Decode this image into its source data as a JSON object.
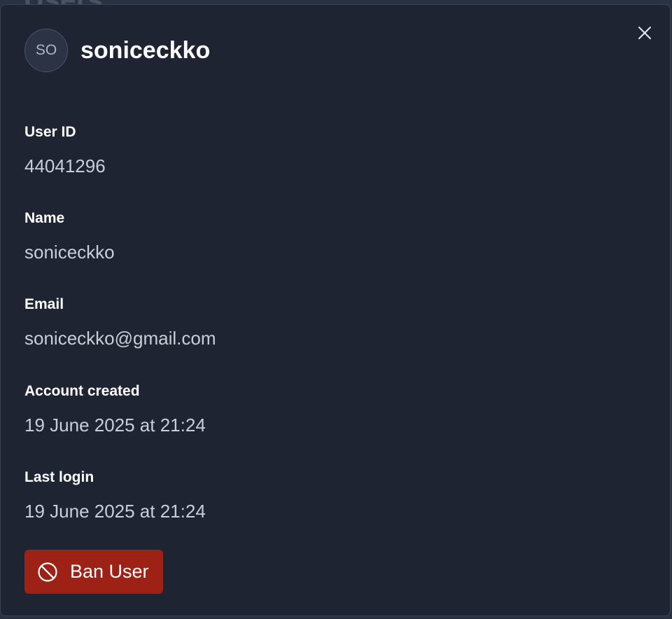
{
  "backdrop": {
    "title": "Users"
  },
  "user": {
    "avatar_initials": "SO",
    "username": "soniceckko"
  },
  "fields": [
    {
      "label": "User ID",
      "value": "44041296"
    },
    {
      "label": "Name",
      "value": "soniceckko"
    },
    {
      "label": "Email",
      "value": "soniceckko@gmail.com"
    },
    {
      "label": "Account created",
      "value": "19 June 2025 at 21:24"
    },
    {
      "label": "Last login",
      "value": "19 June 2025 at 21:24"
    }
  ],
  "actions": {
    "ban_label": "Ban User",
    "ban_icon": "ban-icon",
    "close_icon": "close-icon"
  },
  "colors": {
    "panel_bg": "#1f2433",
    "ban_button": "#9e2116"
  }
}
